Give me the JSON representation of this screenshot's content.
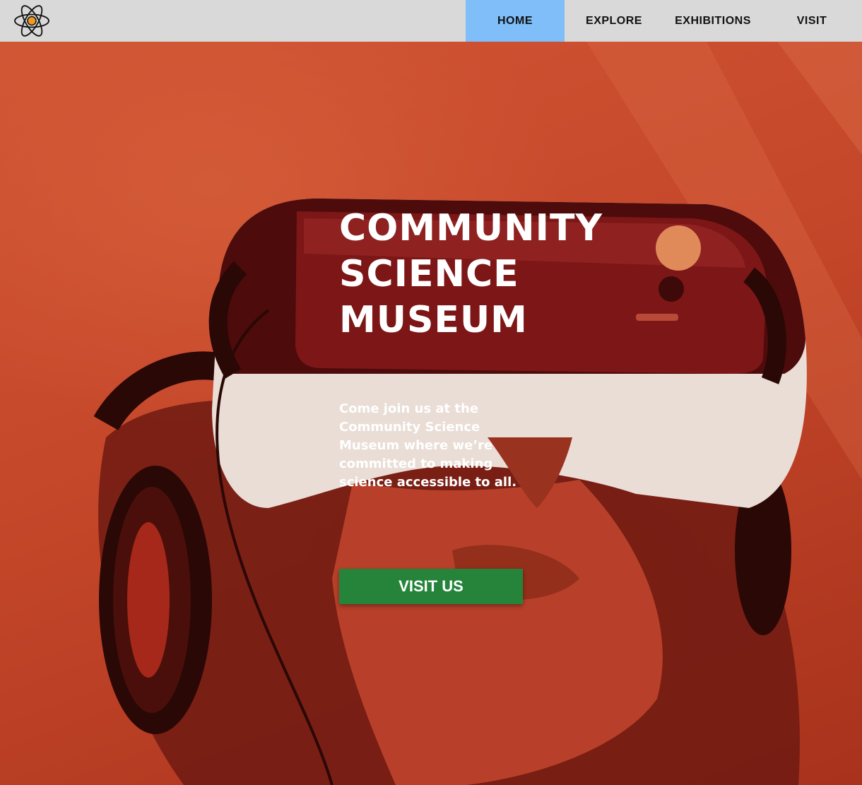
{
  "header": {
    "logo_icon": "atom-icon",
    "nav": [
      {
        "label": "HOME",
        "active": true
      },
      {
        "label": "EXPLORE",
        "active": false
      },
      {
        "label": "EXHIBITIONS",
        "active": false
      },
      {
        "label": "VISIT",
        "active": false
      }
    ]
  },
  "hero": {
    "title_lines": [
      "COMMUNITY",
      "SCIENCE",
      "MUSEUM"
    ],
    "description": "Come join us at the Community Science Museum where we’re committed to making science accessible to all.",
    "cta_label": "VISIT US",
    "image_subject": "person-wearing-vr-headset-photo"
  },
  "colors": {
    "nav_background": "#d9d9d9",
    "nav_active": "#7fbef8",
    "hero_tint": "#c9482a",
    "cta_background": "#25843a",
    "text_light": "#ffffff"
  }
}
